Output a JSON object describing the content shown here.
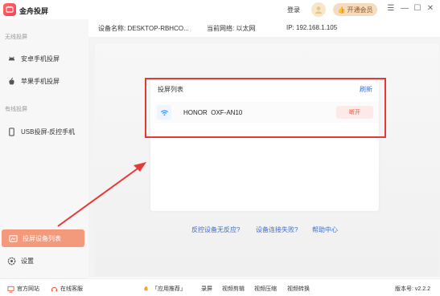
{
  "app": {
    "title": "金舟投屏"
  },
  "header": {
    "login_label": "登录",
    "vip_label": "开通会员",
    "minimize": "—",
    "maximize": "☐",
    "close": "✕",
    "menu": "☰"
  },
  "sidebar": {
    "section_wireless": "无线投屏",
    "android": "安卓手机投屏",
    "apple": "苹果手机投屏",
    "section_wired": "有线投屏",
    "usb": "USB投屏-反控手机",
    "devices": "投屏设备列表",
    "settings": "设置"
  },
  "info": {
    "device_name": "设备名称: DESKTOP-RBHCO...",
    "network": "当前网络: 以太网",
    "ip": "IP: 192.168.1.105"
  },
  "panel": {
    "title": "投屏列表",
    "refresh": "刷新",
    "devices": [
      {
        "name": "HONOR  OXF-AN10",
        "action": "断开"
      }
    ]
  },
  "help": {
    "control_no_response": "反控设备无反应?",
    "connect_failed": "设备连接失败?",
    "help_center": "帮助中心"
  },
  "statusbar": {
    "website": "官方网站",
    "support": "在线客服",
    "recommend": "「应用推荐」",
    "record": "录屏",
    "video_edit": "视频剪辑",
    "video_compress": "视频压缩",
    "video_convert": "视频转换",
    "version": "版本号: v2.2.2"
  },
  "colors": {
    "accent": "#f39a7d",
    "link": "#3b6fd6",
    "highlight": "#e53935",
    "danger": "#e9573f"
  }
}
